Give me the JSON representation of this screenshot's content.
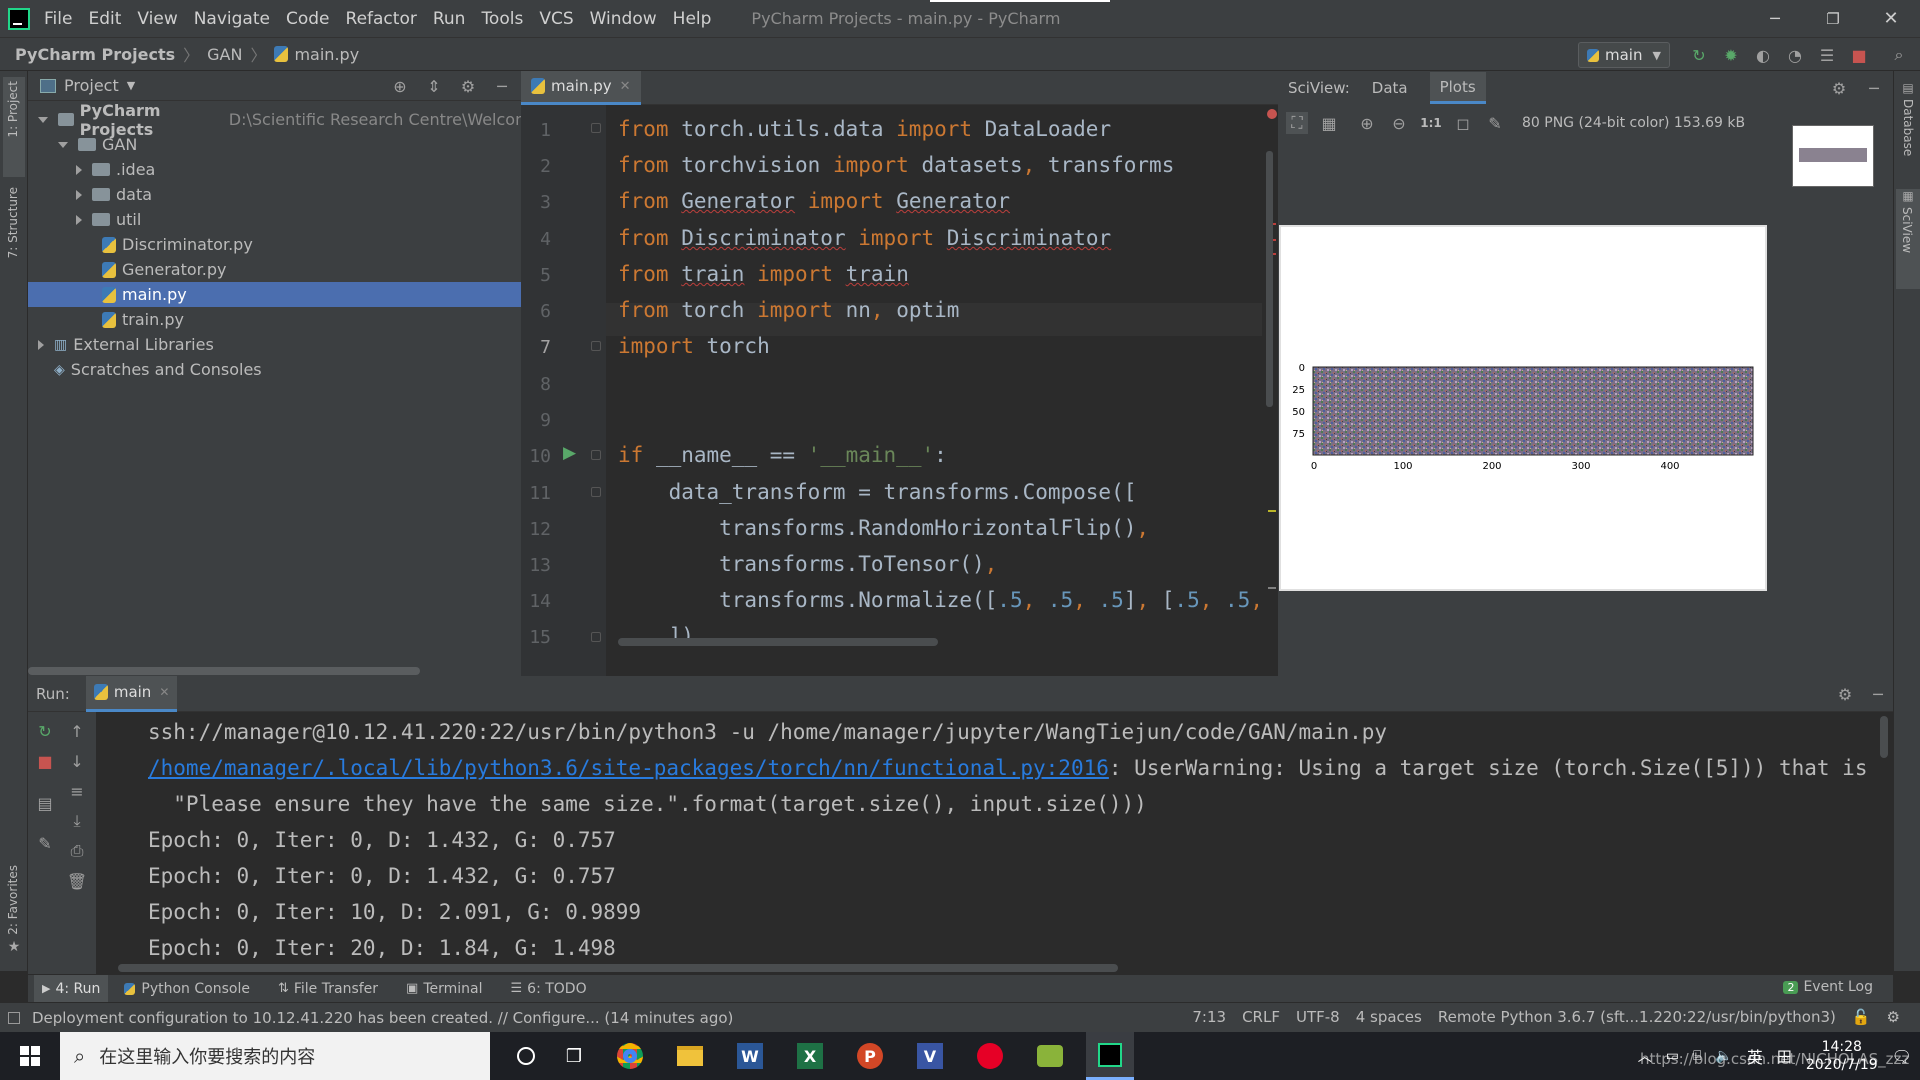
{
  "window": {
    "title": "PyCharm Projects - main.py - PyCharm",
    "menu": [
      "File",
      "Edit",
      "View",
      "Navigate",
      "Code",
      "Refactor",
      "Run",
      "Tools",
      "VCS",
      "Window",
      "Help"
    ]
  },
  "nav": {
    "breadcrumbs": [
      "PyCharm Projects",
      "GAN",
      "main.py"
    ],
    "run_config": "main"
  },
  "left_strip": {
    "project": "1: Project",
    "structure": "7: Structure",
    "favorites": "2: Favorites"
  },
  "right_strip": {
    "database": "Database",
    "sciview": "SciView"
  },
  "project": {
    "header": "Project",
    "root_name": "PyCharm Projects",
    "root_path": "D:\\Scientific Research Centre\\Welcome\\Py",
    "gan": "GAN",
    "folders": [
      ".idea",
      "data",
      "util"
    ],
    "files": [
      "Discriminator.py",
      "Generator.py",
      "main.py",
      "train.py"
    ],
    "external": "External Libraries",
    "scratches": "Scratches and Consoles"
  },
  "editor": {
    "tab": "main.py",
    "line_numbers": [
      "1",
      "2",
      "3",
      "4",
      "5",
      "6",
      "7",
      "8",
      "9",
      "10",
      "11",
      "12",
      "13",
      "14",
      "15"
    ]
  },
  "sciview": {
    "header": "SciView:",
    "tabs": [
      "Data",
      "Plots"
    ],
    "zoom_label": "1:1",
    "image_info": "80 PNG (24-bit color) 153.69 kB",
    "y_ticks": [
      "0",
      "25",
      "50",
      "75"
    ],
    "x_ticks": [
      "0",
      "100",
      "200",
      "300",
      "400"
    ]
  },
  "run": {
    "label": "Run:",
    "tab": "main",
    "lines": {
      "cmd": "ssh://manager@10.12.41.220:22/usr/bin/python3 -u /home/manager/jupyter/WangTiejun/code/GAN/main.py",
      "link": "/home/manager/.local/lib/python3.6/site-packages/torch/nn/functional.py:2016",
      "warn": ": UserWarning: Using a target size (torch.Size([5])) that is",
      "warn2": "  \"Please ensure they have the same size.\".format(target.size(), input.size()))",
      "e1": "Epoch: 0, Iter: 0, D: 1.432, G: 0.757",
      "e2": "Epoch: 0, Iter: 0, D: 1.432, G: 0.757",
      "e3": "Epoch: 0, Iter: 10, D: 2.091, G: 0.9899",
      "e4": "Epoch: 0, Iter: 20, D: 1.84, G: 1.498"
    }
  },
  "bottom_tabs": {
    "run": "4: Run",
    "console": "Python Console",
    "transfer": "File Transfer",
    "terminal": "Terminal",
    "todo": "6: TODO",
    "event": "Event Log",
    "event_count": "2"
  },
  "status": {
    "message": "Deployment configuration to 10.12.41.220 has been created. // Configure... (14 minutes ago)",
    "position": "7:13",
    "line_sep": "CRLF",
    "encoding": "UTF-8",
    "indent": "4 spaces",
    "interpreter": "Remote Python 3.6.7 (sft...1.220:22/usr/bin/python3)"
  },
  "taskbar": {
    "search_placeholder": "在这里输入你要搜索的内容",
    "ime": "英",
    "time": "14:28",
    "date": "2020/7/19",
    "watermark": "https://blog.csdn.net/NICHOLAS_zzz"
  },
  "colors": {
    "accent": "#4b6eaf",
    "bg": "#2b2b2b",
    "panel": "#3c3f41"
  }
}
